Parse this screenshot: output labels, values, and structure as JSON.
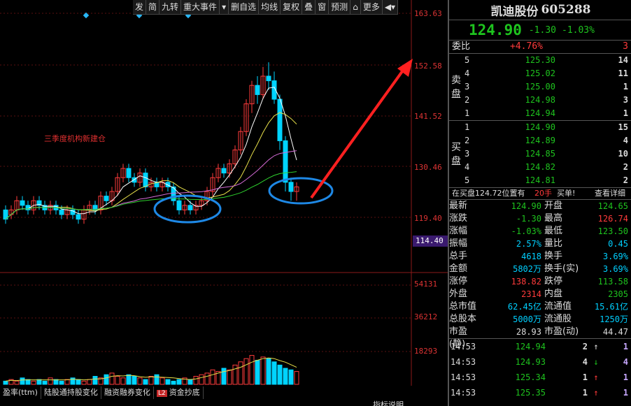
{
  "toolbar": [
    "发",
    "简",
    "九转",
    "重大事件",
    "▾",
    "删自选",
    "均线",
    "复权",
    "叠",
    "窗",
    "预测",
    "⌂",
    "更多",
    "◀▾"
  ],
  "price_axis": [
    "163.63",
    "152.58",
    "141.52",
    "130.46",
    "119.40"
  ],
  "current_tag": "114.40",
  "volume_axis": [
    "54131",
    "36212",
    "18293"
  ],
  "annotation": "三季度机构新建仓",
  "bottom_tabs": [
    "盈率(ttm)",
    "陆股通持股变化",
    "融资融券变化",
    "资金抄底"
  ],
  "bottom_l2": "L2",
  "bottom_note": "指标说明",
  "colors": {
    "up": "#ff3b3b",
    "down": "#00d4ff",
    "ma5": "#ffffff",
    "ma10": "#e8e04a",
    "ma20": "#d46bd6",
    "ma60": "#2ed12e",
    "circle": "#1e88e5",
    "arrow": "#ff2020"
  },
  "stock": {
    "name": "凯迪股份",
    "code": "605288",
    "price": "124.90",
    "change": "-1.30",
    "pct": "-1.03%"
  },
  "weibi": {
    "label": "委比",
    "value": "+4.76%",
    "diff": "3"
  },
  "sell_label": [
    "卖",
    "盘"
  ],
  "buy_label": [
    "买",
    "盘"
  ],
  "sells": [
    {
      "n": "5",
      "p": "125.30",
      "v": "14"
    },
    {
      "n": "4",
      "p": "125.02",
      "v": "11"
    },
    {
      "n": "3",
      "p": "125.00",
      "v": "1"
    },
    {
      "n": "2",
      "p": "124.98",
      "v": "3"
    },
    {
      "n": "1",
      "p": "124.94",
      "v": "1"
    }
  ],
  "buys": [
    {
      "n": "1",
      "p": "124.90",
      "v": "15"
    },
    {
      "n": "2",
      "p": "124.89",
      "v": "4"
    },
    {
      "n": "3",
      "p": "124.85",
      "v": "10"
    },
    {
      "n": "4",
      "p": "124.82",
      "v": "2"
    },
    {
      "n": "5",
      "p": "124.81",
      "v": "2"
    }
  ],
  "buyline": {
    "text": "在买盘124.72位置有",
    "count": "20手",
    "sig": "买单!",
    "link": "查看详细"
  },
  "stats": [
    {
      "k1": "最新",
      "v1": "124.90",
      "c1": "g",
      "k2": "开盘",
      "v2": "124.65",
      "c2": "g"
    },
    {
      "k1": "涨跌",
      "v1": "-1.30",
      "c1": "g",
      "k2": "最高",
      "v2": "126.74",
      "c2": "r"
    },
    {
      "k1": "涨幅",
      "v1": "-1.03%",
      "c1": "g",
      "k2": "最低",
      "v2": "123.50",
      "c2": "g"
    },
    {
      "k1": "振幅",
      "v1": "2.57%",
      "c1": "c",
      "k2": "量比",
      "v2": "0.45",
      "c2": "c"
    },
    {
      "k1": "总手",
      "v1": "4618",
      "c1": "c",
      "k2": "换手",
      "v2": "3.69%",
      "c2": "c"
    },
    {
      "k1": "金额",
      "v1": "5802万",
      "c1": "c",
      "k2": "换手(实)",
      "v2": "3.69%",
      "c2": "c"
    },
    {
      "k1": "涨停",
      "v1": "138.82",
      "c1": "r",
      "k2": "跌停",
      "v2": "113.58",
      "c2": "g"
    },
    {
      "k1": "外盘",
      "v1": "2314",
      "c1": "r",
      "k2": "内盘",
      "v2": "2305",
      "c2": "g"
    },
    {
      "k1": "总市值",
      "v1": "62.45亿",
      "c1": "c",
      "k2": "流通值",
      "v2": "15.61亿",
      "c2": "c"
    },
    {
      "k1": "总股本",
      "v1": "5000万",
      "c1": "c",
      "k2": "流通股",
      "v2": "1250万",
      "c2": "c"
    },
    {
      "k1": "市盈(静)",
      "v1": "28.93",
      "c1": "w",
      "k2": "市盈(动)",
      "v2": "44.47",
      "c2": "w"
    }
  ],
  "ticks": [
    {
      "t": "14:53",
      "p": "124.94",
      "pc": "g",
      "v": "2",
      "a": "↑",
      "ac": "w",
      "n": "1"
    },
    {
      "t": "14:53",
      "p": "124.93",
      "pc": "g",
      "v": "4",
      "a": "↓",
      "ac": "g",
      "n": "4"
    },
    {
      "t": "14:53",
      "p": "125.34",
      "pc": "g",
      "v": "1",
      "a": "↑",
      "ac": "r",
      "n": "1"
    },
    {
      "t": "14:53",
      "p": "125.35",
      "pc": "g",
      "v": "1",
      "a": "↑",
      "ac": "r",
      "n": "1"
    }
  ]
}
